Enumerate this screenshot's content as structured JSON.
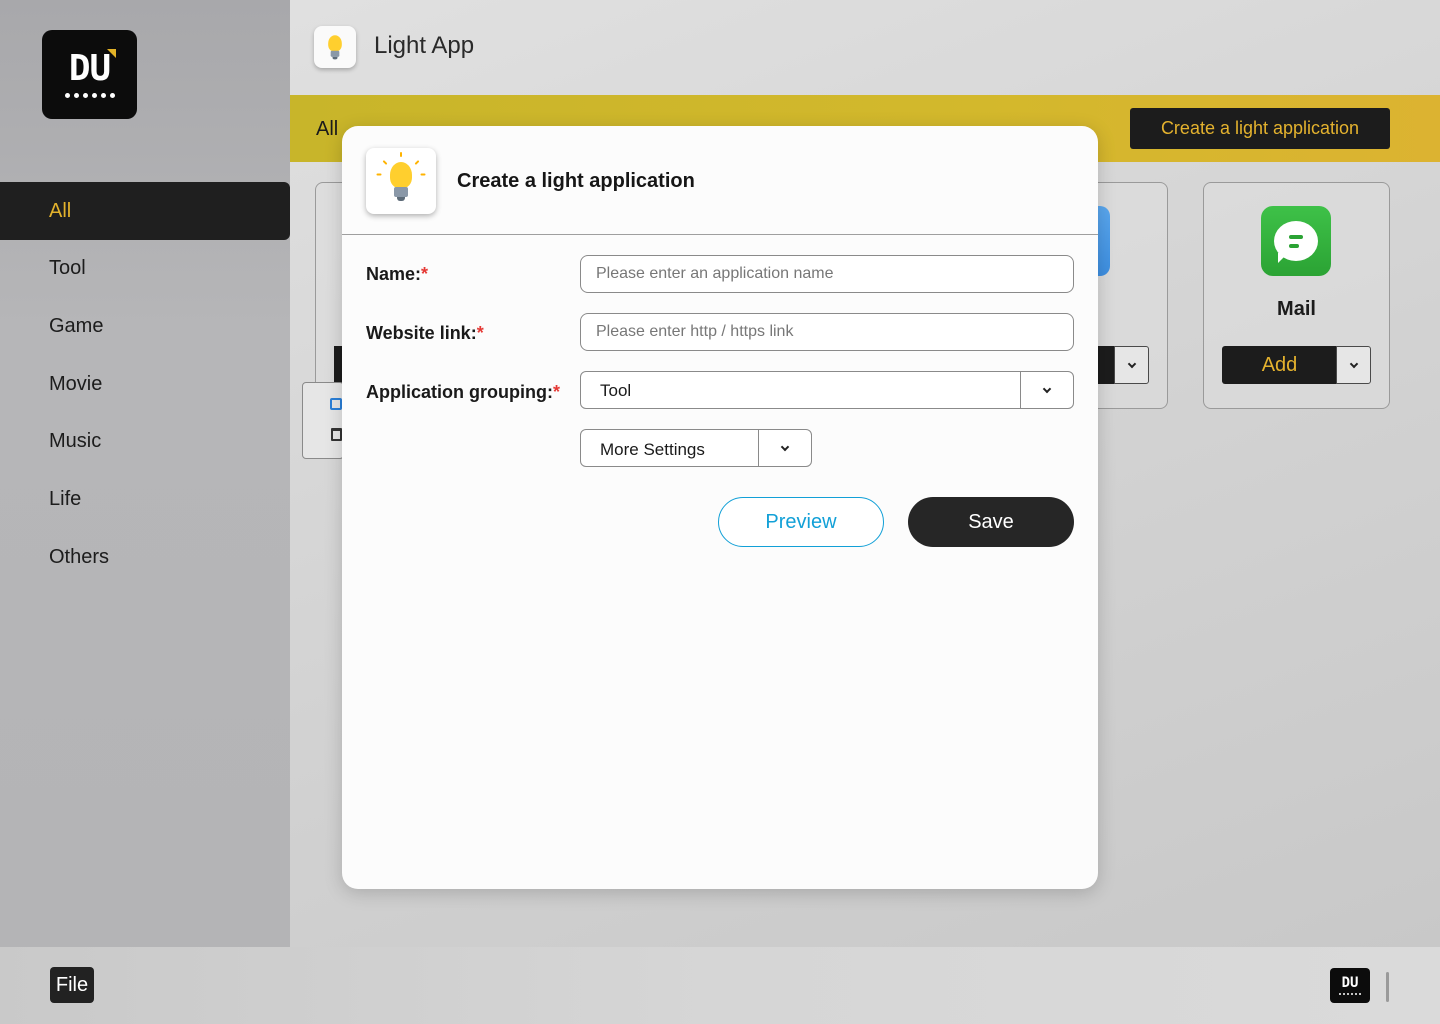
{
  "app": {
    "title": "Light App",
    "icon": "lightbulb-icon"
  },
  "sidebar": {
    "logo": "DU logo",
    "items": [
      {
        "label": "All",
        "active": true
      },
      {
        "label": "Tool",
        "active": false
      },
      {
        "label": "Game",
        "active": false
      },
      {
        "label": "Movie",
        "active": false
      },
      {
        "label": "Music",
        "active": false
      },
      {
        "label": "Life",
        "active": false
      },
      {
        "label": "Others",
        "active": false
      }
    ]
  },
  "filter_bar": {
    "label": "All",
    "create_button": "Create a light application"
  },
  "cards": {
    "mail": {
      "name": "Mail",
      "icon": "chat-bubble-icon",
      "add_label": "Add"
    }
  },
  "modal": {
    "title": "Create a light application",
    "icon": "lightbulb-icon",
    "name_label": "Name:",
    "name_placeholder": "Please enter an application name",
    "name_value": "",
    "link_label": "Website link:",
    "link_placeholder": "Please enter http / https link",
    "link_value": "",
    "grouping_label": "Application grouping:",
    "grouping_value": "Tool",
    "required_mark": "*",
    "more_settings": "More Settings",
    "preview_button": "Preview",
    "save_button": "Save"
  },
  "bottom_bar": {
    "file_button": "File"
  },
  "colors": {
    "accent": "#e4b22e",
    "dark": "#1c1c1c",
    "preview": "#12a0d7",
    "required": "#e53935",
    "yellow_bar": "#d3b82c"
  }
}
